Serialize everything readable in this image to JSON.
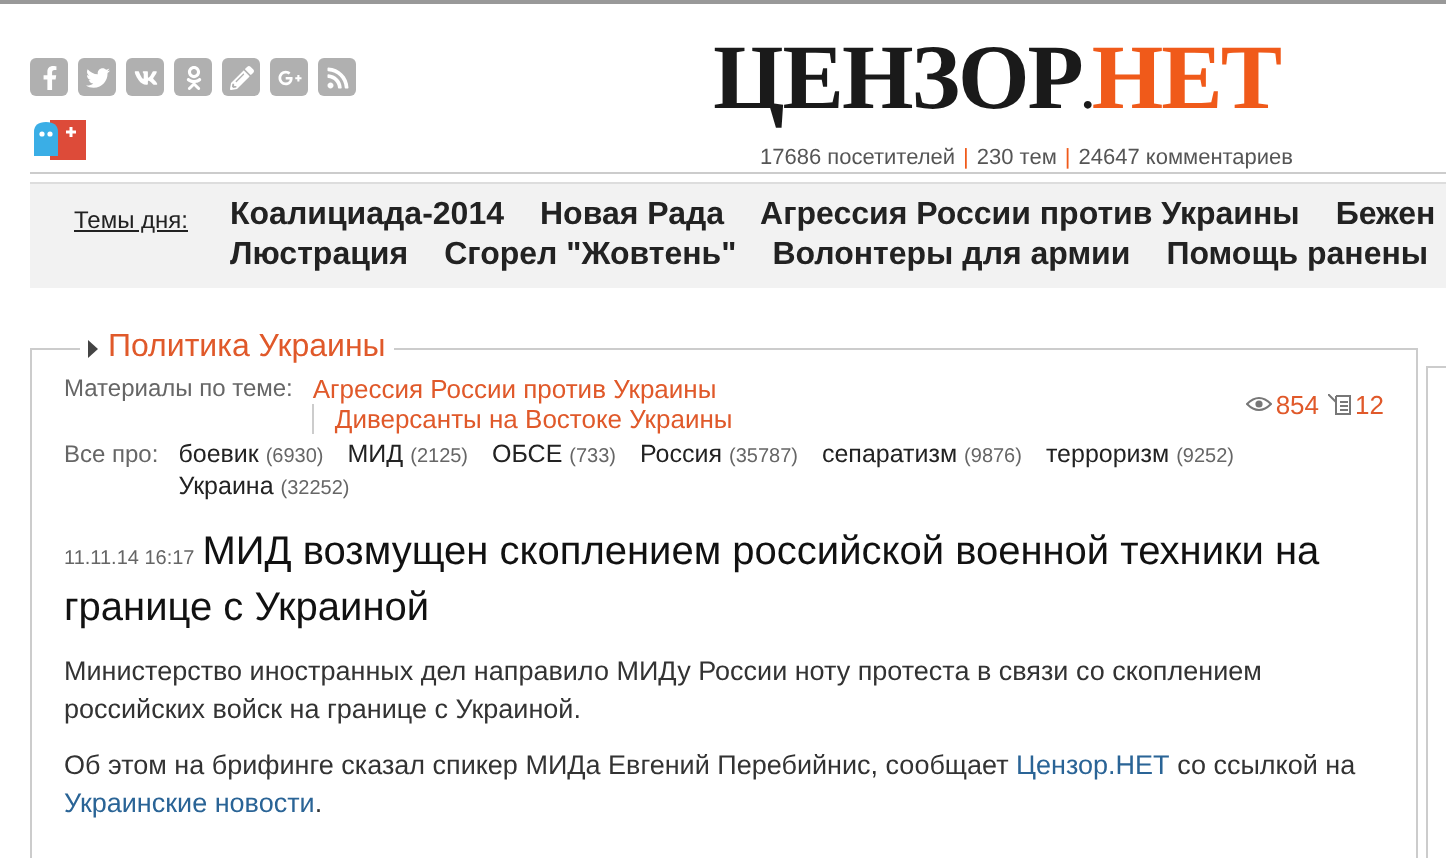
{
  "header": {
    "logo": {
      "dark": "ЦЕНЗОР",
      "dot": ".",
      "accent": "НЕТ"
    },
    "stats": [
      "17686 посетителей",
      "230 тем",
      "24647 комментариев"
    ],
    "stats_separator": "|"
  },
  "topics": {
    "label": "Темы дня:",
    "rows": [
      [
        "Коалициада-2014",
        "Новая Рада",
        "Агрессия России против Украины",
        "Бежен"
      ],
      [
        "Люстрация",
        "Сгорел \"Жовтень\"",
        "Волонтеры для армии",
        "Помощь ранены"
      ]
    ]
  },
  "article": {
    "section": "Политика Украины",
    "related_label": "Материалы по теме:",
    "related": [
      "Агрессия России против Украины",
      "Диверсанты на Востоке Украины"
    ],
    "views": "854",
    "comments": "12",
    "tags_label": "Все про:",
    "tags": [
      {
        "name": "боевик",
        "count": "(6930)"
      },
      {
        "name": "МИД",
        "count": "(2125)"
      },
      {
        "name": "ОБСЕ",
        "count": "(733)"
      },
      {
        "name": "Россия",
        "count": "(35787)"
      },
      {
        "name": "сепаратизм",
        "count": "(9876)"
      },
      {
        "name": "терроризм",
        "count": "(9252)"
      },
      {
        "name": "Украина",
        "count": "(32252)"
      }
    ],
    "date": "11.11.14 16:17",
    "title": "МИД возмущен скоплением российской военной техники на границе с Украиной",
    "paragraphs": [
      [
        {
          "text": "Министерство иностранных дел направило МИДу России ноту протеста в связи со скоплением российских войск на границе с Украиной.",
          "link": false
        }
      ],
      [
        {
          "text": "Об этом на брифинге сказал спикер МИДа Евгений Перебийнис, сообщает ",
          "link": false
        },
        {
          "text": "Цензор.НЕТ",
          "link": true
        },
        {
          "text": " со ссылкой на ",
          "link": false
        },
        {
          "text": "Украинские новости",
          "link": true
        },
        {
          "text": ".",
          "link": false
        }
      ]
    ]
  }
}
